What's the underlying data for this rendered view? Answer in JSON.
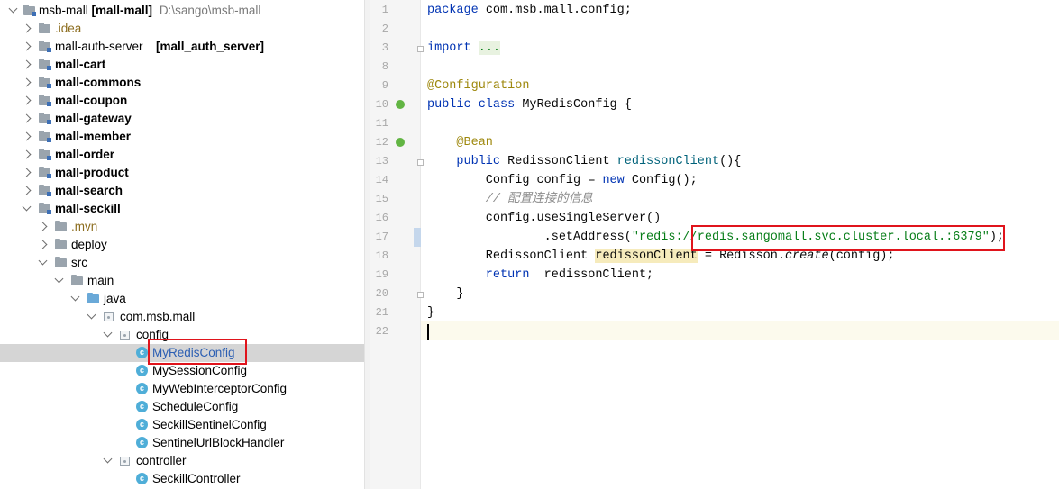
{
  "project_tree": {
    "root": {
      "name": "msb-mall",
      "module": "[mall-mall]",
      "path": "D:\\sango\\msb-mall"
    },
    "items": [
      {
        "label": ".idea",
        "depth": 1,
        "state": "collapsed",
        "icon": "folder-icon",
        "style": "olive"
      },
      {
        "label": "mall-auth-server",
        "suffix": "[mall_auth_server]",
        "depth": 1,
        "state": "collapsed",
        "icon": "module-folder-icon",
        "style": "normal"
      },
      {
        "label": "mall-cart",
        "depth": 1,
        "state": "collapsed",
        "icon": "module-folder-icon",
        "style": "bold"
      },
      {
        "label": "mall-commons",
        "depth": 1,
        "state": "collapsed",
        "icon": "module-folder-icon",
        "style": "bold"
      },
      {
        "label": "mall-coupon",
        "depth": 1,
        "state": "collapsed",
        "icon": "module-folder-icon",
        "style": "bold"
      },
      {
        "label": "mall-gateway",
        "depth": 1,
        "state": "collapsed",
        "icon": "module-folder-icon",
        "style": "bold"
      },
      {
        "label": "mall-member",
        "depth": 1,
        "state": "collapsed",
        "icon": "module-folder-icon",
        "style": "bold"
      },
      {
        "label": "mall-order",
        "depth": 1,
        "state": "collapsed",
        "icon": "module-folder-icon",
        "style": "bold"
      },
      {
        "label": "mall-product",
        "depth": 1,
        "state": "collapsed",
        "icon": "module-folder-icon",
        "style": "bold"
      },
      {
        "label": "mall-search",
        "depth": 1,
        "state": "collapsed",
        "icon": "module-folder-icon",
        "style": "bold"
      },
      {
        "label": "mall-seckill",
        "depth": 1,
        "state": "expanded",
        "icon": "module-folder-icon",
        "style": "bold"
      },
      {
        "label": ".mvn",
        "depth": 2,
        "state": "collapsed",
        "icon": "folder-icon",
        "style": "olive"
      },
      {
        "label": "deploy",
        "depth": 2,
        "state": "collapsed",
        "icon": "folder-icon",
        "style": "normal"
      },
      {
        "label": "src",
        "depth": 2,
        "state": "expanded",
        "icon": "folder-icon",
        "style": "normal"
      },
      {
        "label": "main",
        "depth": 3,
        "state": "expanded",
        "icon": "folder-icon",
        "style": "normal"
      },
      {
        "label": "java",
        "depth": 4,
        "state": "expanded",
        "icon": "source-folder-icon",
        "style": "normal"
      },
      {
        "label": "com.msb.mall",
        "depth": 5,
        "state": "expanded",
        "icon": "package-icon",
        "style": "normal"
      },
      {
        "label": "config",
        "depth": 6,
        "state": "expanded",
        "icon": "package-icon",
        "style": "normal"
      },
      {
        "label": "MyRedisConfig",
        "depth": 7,
        "state": "none",
        "icon": "class-icon",
        "style": "selected"
      },
      {
        "label": "MySessionConfig",
        "depth": 7,
        "state": "none",
        "icon": "class-icon",
        "style": "normal"
      },
      {
        "label": "MyWebInterceptorConfig",
        "depth": 7,
        "state": "none",
        "icon": "class-icon",
        "style": "normal"
      },
      {
        "label": "ScheduleConfig",
        "depth": 7,
        "state": "none",
        "icon": "class-icon",
        "style": "normal"
      },
      {
        "label": "SeckillSentinelConfig",
        "depth": 7,
        "state": "none",
        "icon": "class-icon",
        "style": "normal"
      },
      {
        "label": "SentinelUrlBlockHandler",
        "depth": 7,
        "state": "none",
        "icon": "class-icon",
        "style": "normal"
      },
      {
        "label": "controller",
        "depth": 6,
        "state": "expanded",
        "icon": "package-icon",
        "style": "normal"
      },
      {
        "label": "SeckillController",
        "depth": 7,
        "state": "none",
        "icon": "class-icon",
        "style": "normal"
      }
    ]
  },
  "editor": {
    "current_line": 22,
    "lines": [
      {
        "n": 1,
        "tokens": [
          {
            "t": "package ",
            "c": "kw"
          },
          {
            "t": "com.msb.mall.config;",
            "c": ""
          }
        ]
      },
      {
        "n": 2,
        "tokens": []
      },
      {
        "n": 3,
        "fold": true,
        "tokens": [
          {
            "t": "import ",
            "c": "kw"
          },
          {
            "t": "...",
            "c": "fold-ellipsis"
          }
        ]
      },
      {
        "n": 8,
        "tokens": []
      },
      {
        "n": 9,
        "tokens": [
          {
            "t": "@Configuration",
            "c": "ann"
          }
        ]
      },
      {
        "n": 10,
        "icon": "spring-bean-icon",
        "tokens": [
          {
            "t": "public class ",
            "c": "kw"
          },
          {
            "t": "MyRedisConfig {",
            "c": ""
          }
        ]
      },
      {
        "n": 11,
        "tokens": []
      },
      {
        "n": 12,
        "icon": "spring-bean-icon",
        "tokens": [
          {
            "t": "    @Bean",
            "c": "ann"
          }
        ]
      },
      {
        "n": 13,
        "fold": true,
        "tokens": [
          {
            "t": "    public ",
            "c": "kw"
          },
          {
            "t": "RedissonClient ",
            "c": ""
          },
          {
            "t": "redissonClient",
            "c": "fn"
          },
          {
            "t": "(){",
            "c": ""
          }
        ]
      },
      {
        "n": 14,
        "tokens": [
          {
            "t": "        Config config = ",
            "c": ""
          },
          {
            "t": "new ",
            "c": "kw"
          },
          {
            "t": "Config();",
            "c": ""
          }
        ]
      },
      {
        "n": 15,
        "tokens": [
          {
            "t": "        // 配置连接的信息",
            "c": "cmt"
          }
        ]
      },
      {
        "n": 16,
        "tokens": [
          {
            "t": "        config.useSingleServer()",
            "c": ""
          }
        ]
      },
      {
        "n": 17,
        "caret": true,
        "tokens": [
          {
            "t": "                .setAddress(",
            "c": ""
          },
          {
            "t": "\"redis://redis.sangomall.svc.cluster.local.:6379\"",
            "c": "str"
          },
          {
            "t": ");",
            "c": ""
          }
        ]
      },
      {
        "n": 18,
        "tokens": [
          {
            "t": "        RedissonClient ",
            "c": ""
          },
          {
            "t": "redissonClient",
            "c": "hl"
          },
          {
            "t": " = Redisson.",
            "c": ""
          },
          {
            "t": "create",
            "c": "it"
          },
          {
            "t": "(config);",
            "c": ""
          }
        ]
      },
      {
        "n": 19,
        "tokens": [
          {
            "t": "        return  ",
            "c": "kw"
          },
          {
            "t": "redissonClient;",
            "c": ""
          }
        ]
      },
      {
        "n": 20,
        "fold": true,
        "tokens": [
          {
            "t": "    }",
            "c": ""
          }
        ]
      },
      {
        "n": 21,
        "tokens": [
          {
            "t": "}",
            "c": ""
          }
        ]
      },
      {
        "n": 22,
        "tokens": []
      }
    ]
  },
  "annotations": {
    "box_color": "#e0141c"
  }
}
